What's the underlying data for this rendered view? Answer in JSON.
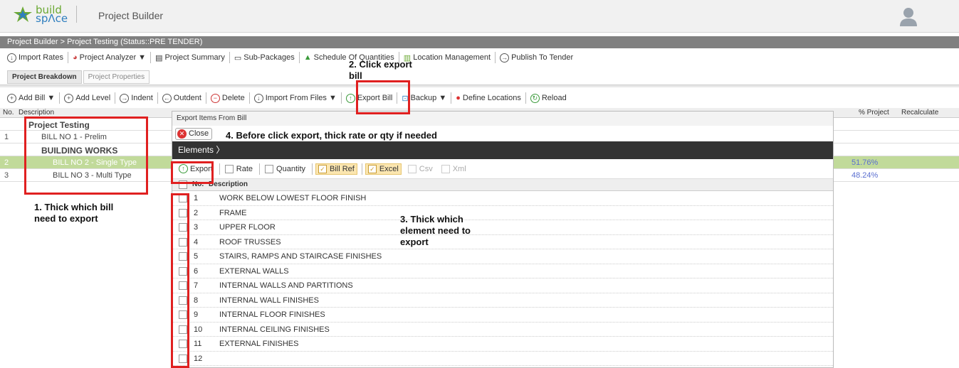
{
  "header": {
    "logo_top": "build",
    "logo_bottom": "spΛce",
    "app_title": "Project Builder"
  },
  "breadcrumb": "Project Builder > Project Testing (Status::PRE TENDER)",
  "top_toolbar": [
    {
      "label": "Import Rates"
    },
    {
      "label": "Project Analyzer ▼"
    },
    {
      "label": "Project Summary"
    },
    {
      "label": "Sub-Packages"
    },
    {
      "label": "Schedule Of Quantities"
    },
    {
      "label": "Location Management"
    },
    {
      "label": "Publish To Tender"
    }
  ],
  "tabs": [
    {
      "label": "Project Breakdown"
    },
    {
      "label": "Project Properties"
    }
  ],
  "action_toolbar": [
    {
      "label": "Add Bill ▼"
    },
    {
      "label": "Add Level"
    },
    {
      "label": "Indent"
    },
    {
      "label": "Outdent"
    },
    {
      "label": "Delete"
    },
    {
      "label": "Import From Files ▼"
    },
    {
      "label": "Export Bill"
    },
    {
      "label": "Backup ▼"
    },
    {
      "label": "Define Locations"
    },
    {
      "label": "Reload"
    }
  ],
  "grid": {
    "headers": {
      "no": "No.",
      "desc": "Description",
      "pct": "% Project",
      "recalc": "Recalculate"
    },
    "rows": [
      {
        "no": "",
        "desc": "Project Testing",
        "pct": ""
      },
      {
        "no": "1",
        "desc": "BILL NO 1 - Prelim",
        "pct": ""
      },
      {
        "no": "",
        "desc": "BUILDING WORKS",
        "pct": ""
      },
      {
        "no": "2",
        "desc": "BILL NO 2 - Single Type",
        "pct": "51.76%"
      },
      {
        "no": "3",
        "desc": "BILL NO 3 - Multi Type",
        "pct": "48.24%"
      }
    ]
  },
  "modal": {
    "title": "Export Items From Bill",
    "close_label": "Close",
    "breadcrumb": "Elements",
    "export_label": "Export",
    "options": [
      {
        "label": "Rate"
      },
      {
        "label": "Quantity"
      },
      {
        "label": "Bill Ref"
      },
      {
        "label": "Excel"
      },
      {
        "label": "Csv"
      },
      {
        "label": "Xml"
      }
    ],
    "col_no": "No.",
    "col_desc": "Description",
    "elements": [
      {
        "no": "1",
        "desc": "WORK BELOW LOWEST FLOOR FINISH"
      },
      {
        "no": "2",
        "desc": "FRAME"
      },
      {
        "no": "3",
        "desc": "UPPER FLOOR"
      },
      {
        "no": "4",
        "desc": "ROOF TRUSSES"
      },
      {
        "no": "5",
        "desc": "STAIRS, RAMPS AND STAIRCASE FINISHES"
      },
      {
        "no": "6",
        "desc": "EXTERNAL WALLS"
      },
      {
        "no": "7",
        "desc": "INTERNAL WALLS AND PARTITIONS"
      },
      {
        "no": "8",
        "desc": "INTERNAL WALL FINISHES"
      },
      {
        "no": "9",
        "desc": "INTERNAL FLOOR FINISHES"
      },
      {
        "no": "10",
        "desc": "INTERNAL CEILING FINISHES"
      },
      {
        "no": "11",
        "desc": "EXTERNAL FINISHES"
      },
      {
        "no": "12",
        "desc": ""
      }
    ]
  },
  "annotations": {
    "a1": "1. Thick which bill need to export",
    "a2": "2. Click export bill",
    "a3": "3. Thick which element need to export",
    "a4": "4. Before click export, thick rate or qty if needed"
  }
}
